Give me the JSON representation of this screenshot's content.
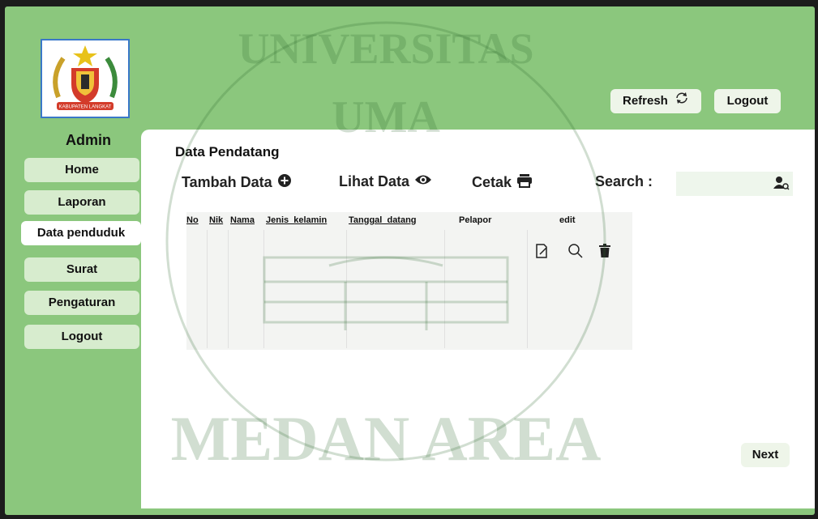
{
  "header": {
    "refresh_label": "Refresh",
    "logout_label": "Logout",
    "logo_text": "KABUPATEN LANGKAT"
  },
  "sidebar": {
    "role": "Admin",
    "items": [
      {
        "label": "Home"
      },
      {
        "label": "Laporan"
      },
      {
        "label": "Data penduduk"
      },
      {
        "label": "Surat"
      },
      {
        "label": "Pengaturan"
      },
      {
        "label": "Logout"
      }
    ]
  },
  "main": {
    "title": "Data Pendatang",
    "actions": {
      "add": "Tambah Data",
      "view": "Lihat Data",
      "print": "Cetak",
      "search": "Search :"
    },
    "search_value": "",
    "table": {
      "columns": [
        "No",
        "Nik",
        "Nama",
        "Jenis_kelamin",
        "Tanggal_datang",
        "Pelapor",
        "edit"
      ]
    },
    "next_label": "Next"
  },
  "watermark": {
    "text_top": "UNIVERSITAS",
    "text_bottom": "MEDAN AREA",
    "center": "UMA"
  },
  "colors": {
    "background": "#8bc77d",
    "nav_button": "#d7ecce",
    "panel": "#ffffff"
  }
}
